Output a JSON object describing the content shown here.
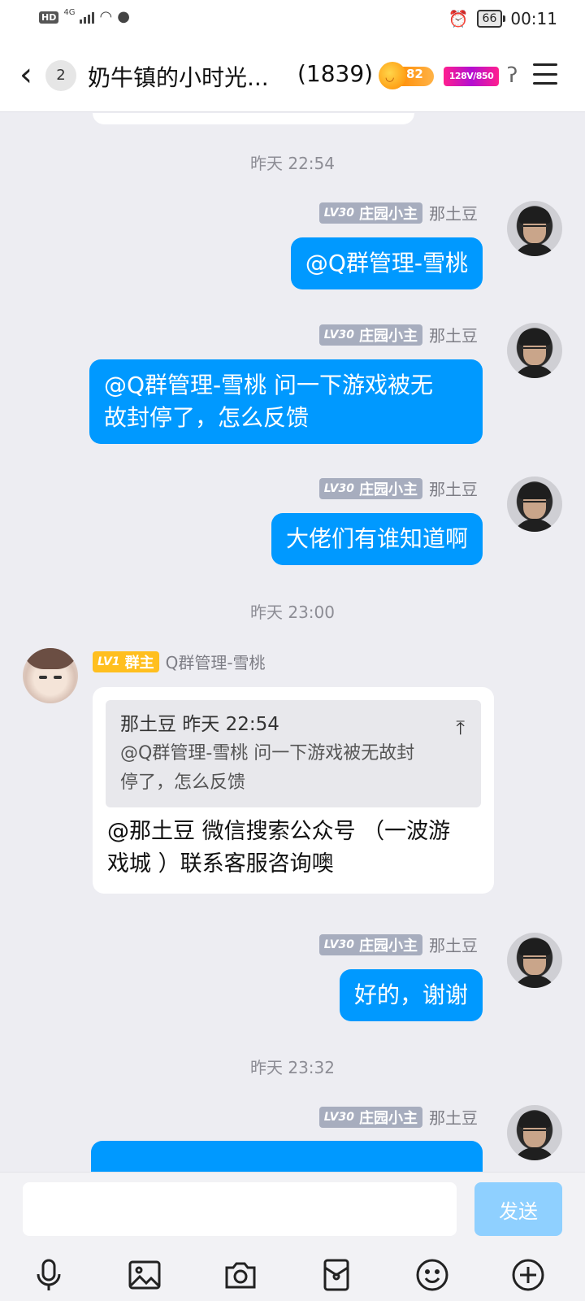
{
  "status_bar": {
    "hd": "HD",
    "network": "4G",
    "battery": "66",
    "time": "00:11"
  },
  "header": {
    "back_icon": "chevron-left-icon",
    "unread_count": "2",
    "group_title": "奶牛镇的小时光...",
    "member_count": "(1839)",
    "fire_level": "82",
    "badge_text": "128V/850"
  },
  "timestamps": [
    "昨天 22:54",
    "昨天 23:00",
    "昨天 23:32"
  ],
  "me": {
    "level": "LV30",
    "title": "庄园小主",
    "name": "那土豆"
  },
  "her": {
    "level": "LV1",
    "title": "群主",
    "name": "Q群管理-雪桃"
  },
  "messages": [
    {
      "text": "@Q群管理-雪桃"
    },
    {
      "line1": "@Q群管理-雪桃 问一下游戏被无",
      "line2": "故封停了，怎么反馈"
    },
    {
      "text": "大佬们有谁知道啊"
    },
    {
      "quote_head": "那土豆 昨天 22:54",
      "quote_line1": "@Q群管理-雪桃 问一下游戏被无故封",
      "quote_line2": "停了，怎么反馈",
      "line1": "@那土豆 微信搜索公众号 （一波游",
      "line2": "戏城 ）联系客服咨询噢"
    },
    {
      "text": "好的，谢谢"
    }
  ],
  "input": {
    "placeholder": "",
    "send_label": "发送"
  }
}
